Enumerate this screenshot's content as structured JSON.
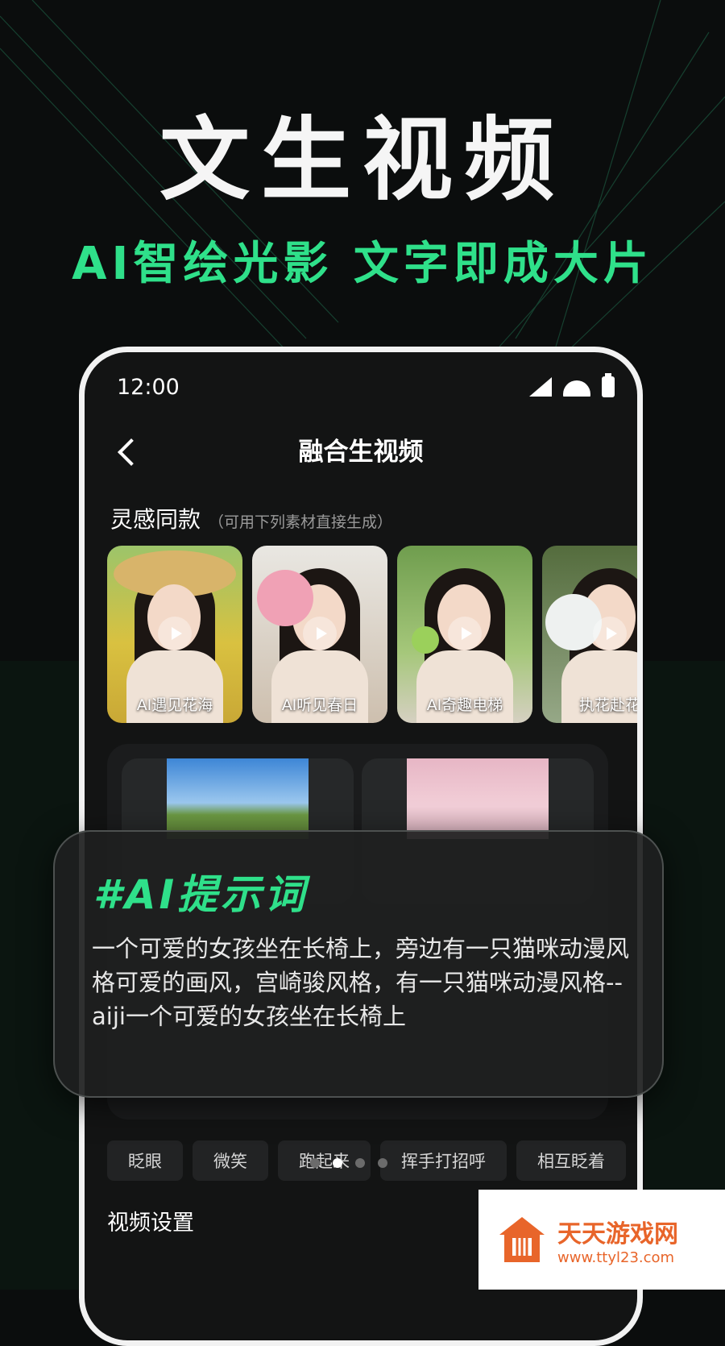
{
  "hero": {
    "title": "文生视频",
    "subtitle": "AI智绘光影 文字即成大片"
  },
  "status_bar": {
    "time": "12:00"
  },
  "nav": {
    "title": "融合生视频"
  },
  "inspiration": {
    "heading": "灵感同款",
    "hint": "（可用下列素材直接生成）",
    "cards": [
      {
        "label": "AI遇见花海"
      },
      {
        "label": "AI听见春日"
      },
      {
        "label": "AI奇趣电梯"
      },
      {
        "label": "执花赴花"
      }
    ]
  },
  "actions": {
    "tags": [
      "眨眼",
      "微笑",
      "跑起来",
      "挥手打招呼",
      "相互眨着"
    ]
  },
  "video_settings": {
    "heading": "视频设置"
  },
  "prompt_card": {
    "title": "#AI提示词",
    "text": "一个可爱的女孩坐在长椅上，旁边有一只猫咪动漫风格可爱的画风，宫崎骏风格，有一只猫咪动漫风格--aiji一个可爱的女孩坐在长椅上"
  },
  "watermark": {
    "name": "天天游戏网",
    "url": "www.ttyl23.com"
  },
  "colors": {
    "accent": "#2fe08a",
    "background": "#0b0d0d",
    "phone_frame": "#f2f2f2",
    "watermark": "#e8652a"
  }
}
